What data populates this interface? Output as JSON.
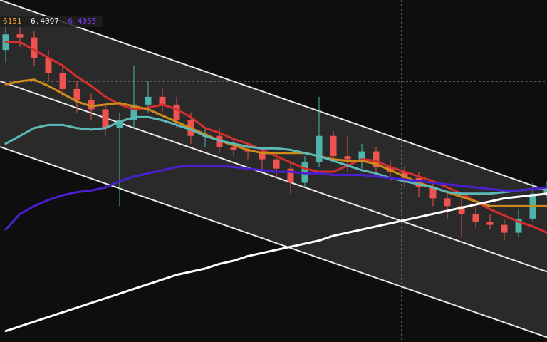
{
  "chart_data": {
    "type": "line",
    "title": "",
    "theme": {
      "background": "#0e0e0e",
      "channel_fill": "#2a2a2a",
      "up_color": "#4db6ac",
      "down_color": "#ef5350",
      "crosshair": "#9e9e9e"
    },
    "visible_labels": [
      {
        "text": "6151",
        "color": "#f0a030"
      },
      {
        "text": "6.4097",
        "color": "#f0f0f0"
      },
      {
        "text": "6.4035",
        "color": "#7b3cff"
      }
    ],
    "series": [
      {
        "style": "ma",
        "color": "#d32f2f",
        "values": [
          6.55,
          6.55,
          6.5,
          6.45,
          6.4,
          6.33,
          6.27,
          6.2,
          6.15,
          6.12,
          6.13,
          6.15,
          6.12,
          6.07,
          6.0,
          5.97,
          5.93,
          5.9,
          5.86,
          5.82,
          5.78,
          5.74,
          5.72,
          5.72,
          5.76,
          5.8,
          5.79,
          5.75,
          5.72,
          5.69,
          5.66,
          5.62,
          5.58,
          5.53,
          5.48,
          5.44,
          5.4,
          5.37,
          5.33
        ]
      },
      {
        "style": "ma",
        "color": "#d08a1a",
        "values": [
          6.28,
          6.3,
          6.31,
          6.27,
          6.22,
          6.17,
          6.14,
          6.15,
          6.16,
          6.14,
          6.12,
          6.08,
          6.04,
          6.0,
          5.96,
          5.92,
          5.89,
          5.86,
          5.84,
          5.84,
          5.84,
          5.84,
          5.82,
          5.8,
          5.79,
          5.79,
          5.77,
          5.73,
          5.69,
          5.65,
          5.62,
          5.59,
          5.56,
          5.53,
          5.5,
          5.5,
          5.5,
          5.5,
          5.5
        ]
      },
      {
        "style": "ma",
        "color": "#5fb8b8",
        "values": [
          5.9,
          5.95,
          6.0,
          6.02,
          6.02,
          6.0,
          5.99,
          6.0,
          6.04,
          6.07,
          6.07,
          6.05,
          6.02,
          5.99,
          5.95,
          5.92,
          5.9,
          5.88,
          5.87,
          5.87,
          5.86,
          5.84,
          5.82,
          5.79,
          5.76,
          5.73,
          5.71,
          5.68,
          5.66,
          5.64,
          5.62,
          5.59,
          5.58,
          5.58,
          5.58,
          5.59,
          5.6,
          5.61,
          5.61
        ]
      },
      {
        "style": "ma",
        "color": "#4a1fd0",
        "values": [
          5.35,
          5.45,
          5.5,
          5.54,
          5.57,
          5.59,
          5.6,
          5.62,
          5.66,
          5.69,
          5.71,
          5.73,
          5.75,
          5.76,
          5.76,
          5.76,
          5.75,
          5.74,
          5.73,
          5.72,
          5.72,
          5.71,
          5.71,
          5.7,
          5.7,
          5.7,
          5.69,
          5.68,
          5.67,
          5.66,
          5.65,
          5.64,
          5.63,
          5.62,
          5.61,
          5.6,
          5.6,
          5.61,
          5.62
        ]
      },
      {
        "style": "ma",
        "color": "#ffffff",
        "values": [
          4.7,
          4.73,
          4.76,
          4.79,
          4.82,
          4.85,
          4.88,
          4.91,
          4.94,
          4.97,
          5.0,
          5.03,
          5.06,
          5.08,
          5.1,
          5.13,
          5.15,
          5.18,
          5.2,
          5.22,
          5.24,
          5.26,
          5.28,
          5.31,
          5.33,
          5.35,
          5.37,
          5.39,
          5.41,
          5.43,
          5.45,
          5.47,
          5.49,
          5.51,
          5.53,
          5.55,
          5.56,
          5.57,
          5.58
        ]
      }
    ],
    "candles": {
      "open": [
        6.5,
        6.6,
        6.58,
        6.45,
        6.35,
        6.25,
        6.18,
        6.12,
        6.0,
        6.05,
        6.15,
        6.2,
        6.15,
        6.05,
        5.95,
        5.95,
        5.88,
        5.86,
        5.85,
        5.8,
        5.74,
        5.65,
        5.78,
        5.95,
        5.82,
        5.8,
        5.85,
        5.75,
        5.72,
        5.68,
        5.62,
        5.55,
        5.5,
        5.45,
        5.4,
        5.38,
        5.33,
        5.42,
        5.58
      ],
      "close": [
        6.6,
        6.58,
        6.45,
        6.35,
        6.25,
        6.18,
        6.12,
        6.0,
        6.05,
        6.15,
        6.2,
        6.15,
        6.05,
        5.95,
        5.95,
        5.88,
        5.86,
        5.85,
        5.8,
        5.74,
        5.65,
        5.78,
        5.95,
        5.82,
        5.8,
        5.85,
        5.75,
        5.72,
        5.68,
        5.62,
        5.55,
        5.5,
        5.45,
        5.4,
        5.38,
        5.33,
        5.42,
        5.58,
        5.62
      ],
      "high": [
        6.7,
        6.7,
        6.62,
        6.5,
        6.4,
        6.3,
        6.22,
        6.16,
        6.1,
        6.4,
        6.3,
        6.25,
        6.2,
        6.1,
        6.0,
        6.0,
        5.92,
        5.9,
        5.88,
        5.84,
        5.78,
        5.82,
        6.2,
        5.98,
        5.95,
        5.9,
        5.88,
        5.8,
        5.76,
        5.72,
        5.66,
        5.6,
        5.55,
        5.5,
        5.45,
        5.42,
        5.48,
        5.65,
        5.66
      ],
      "low": [
        6.42,
        6.52,
        6.4,
        6.3,
        6.2,
        6.1,
        6.05,
        5.95,
        5.5,
        6.0,
        6.1,
        6.1,
        6.0,
        5.9,
        5.88,
        5.84,
        5.82,
        5.8,
        5.72,
        5.68,
        5.58,
        5.62,
        5.75,
        5.78,
        5.72,
        5.74,
        5.7,
        5.66,
        5.62,
        5.56,
        5.5,
        5.42,
        5.3,
        5.36,
        5.35,
        5.28,
        5.3,
        5.4,
        5.55
      ]
    },
    "channel": {
      "upper_start": 6.82,
      "upper_end": 5.6,
      "lower_start": 6.3,
      "lower_end": 5.08,
      "bottom_start": 5.88,
      "bottom_end": 4.66
    },
    "crosshair": {
      "time_index": 27.8,
      "price": 6.3
    },
    "ylim": [
      4.63,
      6.82
    ],
    "grid": false,
    "legend": "none"
  }
}
